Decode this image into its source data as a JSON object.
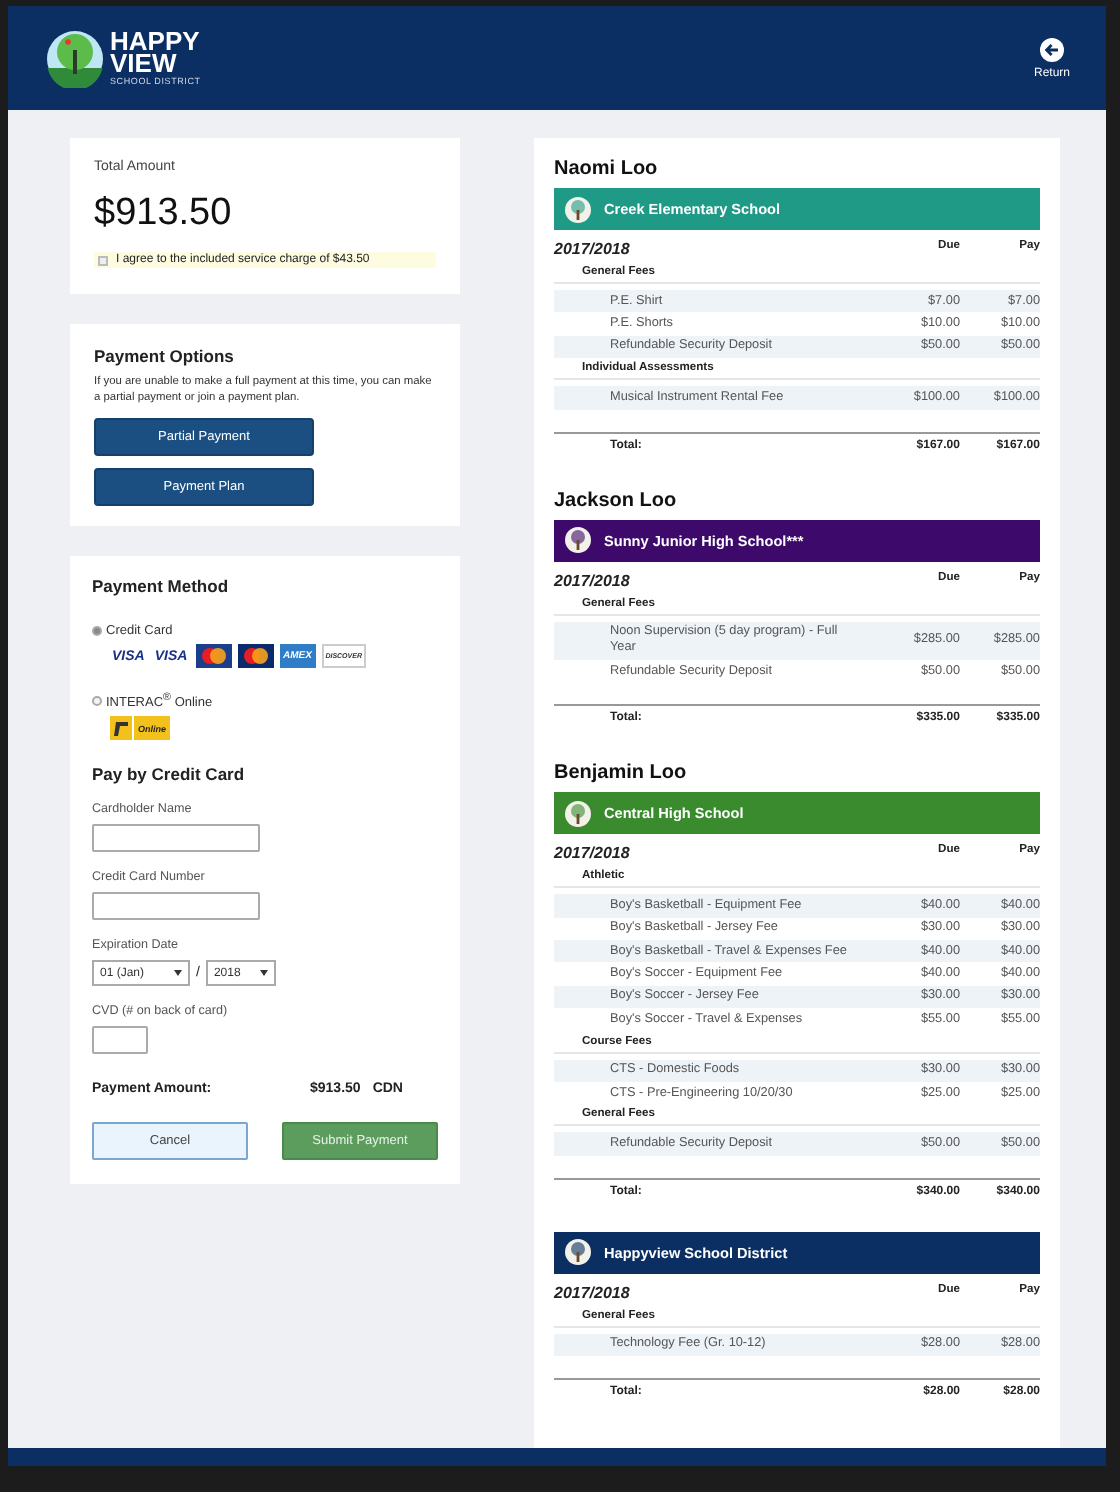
{
  "header": {
    "logo_line1": "HAPPY",
    "logo_line2": "VIEW",
    "logo_sub": "SCHOOL DISTRICT",
    "return_label": "Return"
  },
  "total": {
    "label": "Total Amount",
    "amount": "$913.50",
    "agree": {
      "label": "I agree to the included service charge of $43.50",
      "checked": false
    }
  },
  "payment_options": {
    "title": "Payment Options",
    "description": "If you are unable to make a full payment at this time, you can make a partial payment or join a payment plan.",
    "buttons": [
      "Partial Payment",
      "Payment Plan"
    ]
  },
  "payment_method": {
    "title": "Payment Method",
    "methods": [
      {
        "label": "Credit Card",
        "selected": true,
        "logos": [
          {
            "kind": "visa",
            "text": "VISA"
          },
          {
            "kind": "visa-debit",
            "text": "VISA"
          },
          {
            "kind": "mastercard"
          },
          {
            "kind": "mastercard-debit"
          },
          {
            "kind": "amex",
            "text": "AMEX"
          },
          {
            "kind": "discover",
            "text": "DISCOVER"
          }
        ]
      },
      {
        "label": "INTERAC$^{®}$ Online",
        "selected": false,
        "logos": [
          {
            "kind": "interac",
            "text": "Online"
          }
        ]
      }
    ]
  },
  "credit_card": {
    "title": "Pay by Credit Card",
    "fields": [
      {
        "kind": "text",
        "label": "Cardholder Name"
      },
      {
        "kind": "text",
        "label": "Credit Card Number"
      },
      {
        "kind": "date",
        "label": "Expiration Date",
        "month": "01 (Jan)",
        "separator": "/",
        "year": "2018"
      },
      {
        "kind": "short",
        "label": "CVD (# on back of card)"
      }
    ],
    "amount_label": "Payment Amount:",
    "amount": "$913.50",
    "currency": "CDN",
    "buttons": [
      {
        "kind": "secondary",
        "label": "Cancel"
      },
      {
        "kind": "primary",
        "label": "Submit Payment"
      }
    ]
  },
  "students": [
    {
      "name": "Naomi Loo",
      "school": {
        "name": "Creek Elementary School",
        "color": "#1f9a87"
      },
      "year": "2017/2018",
      "due_header": "Due",
      "pay_header": "Pay",
      "groups": [
        {
          "title": "General Fees",
          "items": [
            {
              "label": "P.E. Shirt",
              "due": "$7.00",
              "pay": "$7.00"
            },
            {
              "label": "P.E. Shorts",
              "due": "$10.00",
              "pay": "$10.00"
            },
            {
              "label": "Refundable Security Deposit",
              "due": "$50.00",
              "pay": "$50.00"
            }
          ]
        },
        {
          "title": "Individual Assessments",
          "items": [
            {
              "label": "Musical Instrument Rental Fee",
              "due": "$100.00",
              "pay": "$100.00"
            }
          ]
        }
      ],
      "total_label": "Total:",
      "total_due": "$167.00",
      "total_pay": "$167.00"
    },
    {
      "name": "Jackson Loo",
      "school": {
        "name": "Sunny Junior High School***",
        "color": "#3d0a6b"
      },
      "year": "2017/2018",
      "due_header": "Due",
      "pay_header": "Pay",
      "groups": [
        {
          "title": "General Fees",
          "items": [
            {
              "label": "Noon Supervision (5 day program) - Full Year",
              "due": "$285.00",
              "pay": "$285.00"
            },
            {
              "label": "Refundable Security Deposit",
              "due": "$50.00",
              "pay": "$50.00"
            }
          ]
        }
      ],
      "total_label": "Total:",
      "total_due": "$335.00",
      "total_pay": "$335.00"
    },
    {
      "name": "Benjamin Loo",
      "school": {
        "name": "Central High School",
        "color": "#3a8a2e"
      },
      "year": "2017/2018",
      "due_header": "Due",
      "pay_header": "Pay",
      "groups": [
        {
          "title": "Athletic",
          "items": [
            {
              "label": "Boy's Basketball - Equipment Fee",
              "due": "$40.00",
              "pay": "$40.00"
            },
            {
              "label": "Boy's Basketball - Jersey Fee",
              "due": "$30.00",
              "pay": "$30.00"
            },
            {
              "label": "Boy's Basketball - Travel & Expenses Fee",
              "due": "$40.00",
              "pay": "$40.00"
            },
            {
              "label": "Boy's Soccer - Equipment Fee",
              "due": "$40.00",
              "pay": "$40.00"
            },
            {
              "label": "Boy's Soccer - Jersey Fee",
              "due": "$30.00",
              "pay": "$30.00"
            },
            {
              "label": "Boy's Soccer - Travel & Expenses",
              "due": "$55.00",
              "pay": "$55.00"
            }
          ]
        },
        {
          "title": "Course Fees",
          "items": [
            {
              "label": "CTS - Domestic Foods",
              "due": "$30.00",
              "pay": "$30.00"
            },
            {
              "label": "CTS - Pre-Engineering 10/20/30",
              "due": "$25.00",
              "pay": "$25.00"
            }
          ]
        },
        {
          "title": "General Fees",
          "items": [
            {
              "label": "Refundable Security Deposit",
              "due": "$50.00",
              "pay": "$50.00"
            }
          ]
        }
      ],
      "total_label": "Total:",
      "total_due": "$340.00",
      "total_pay": "$340.00"
    },
    {
      "school": {
        "name": "Happyview School District",
        "color": "#0b2f63"
      },
      "year": "2017/2018",
      "due_header": "Due",
      "pay_header": "Pay",
      "groups": [
        {
          "title": "General Fees",
          "items": [
            {
              "label": "Technology Fee (Gr. 10-12)",
              "due": "$28.00",
              "pay": "$28.00"
            }
          ]
        }
      ],
      "total_label": "Total:",
      "total_due": "$28.00",
      "total_pay": "$28.00"
    }
  ]
}
